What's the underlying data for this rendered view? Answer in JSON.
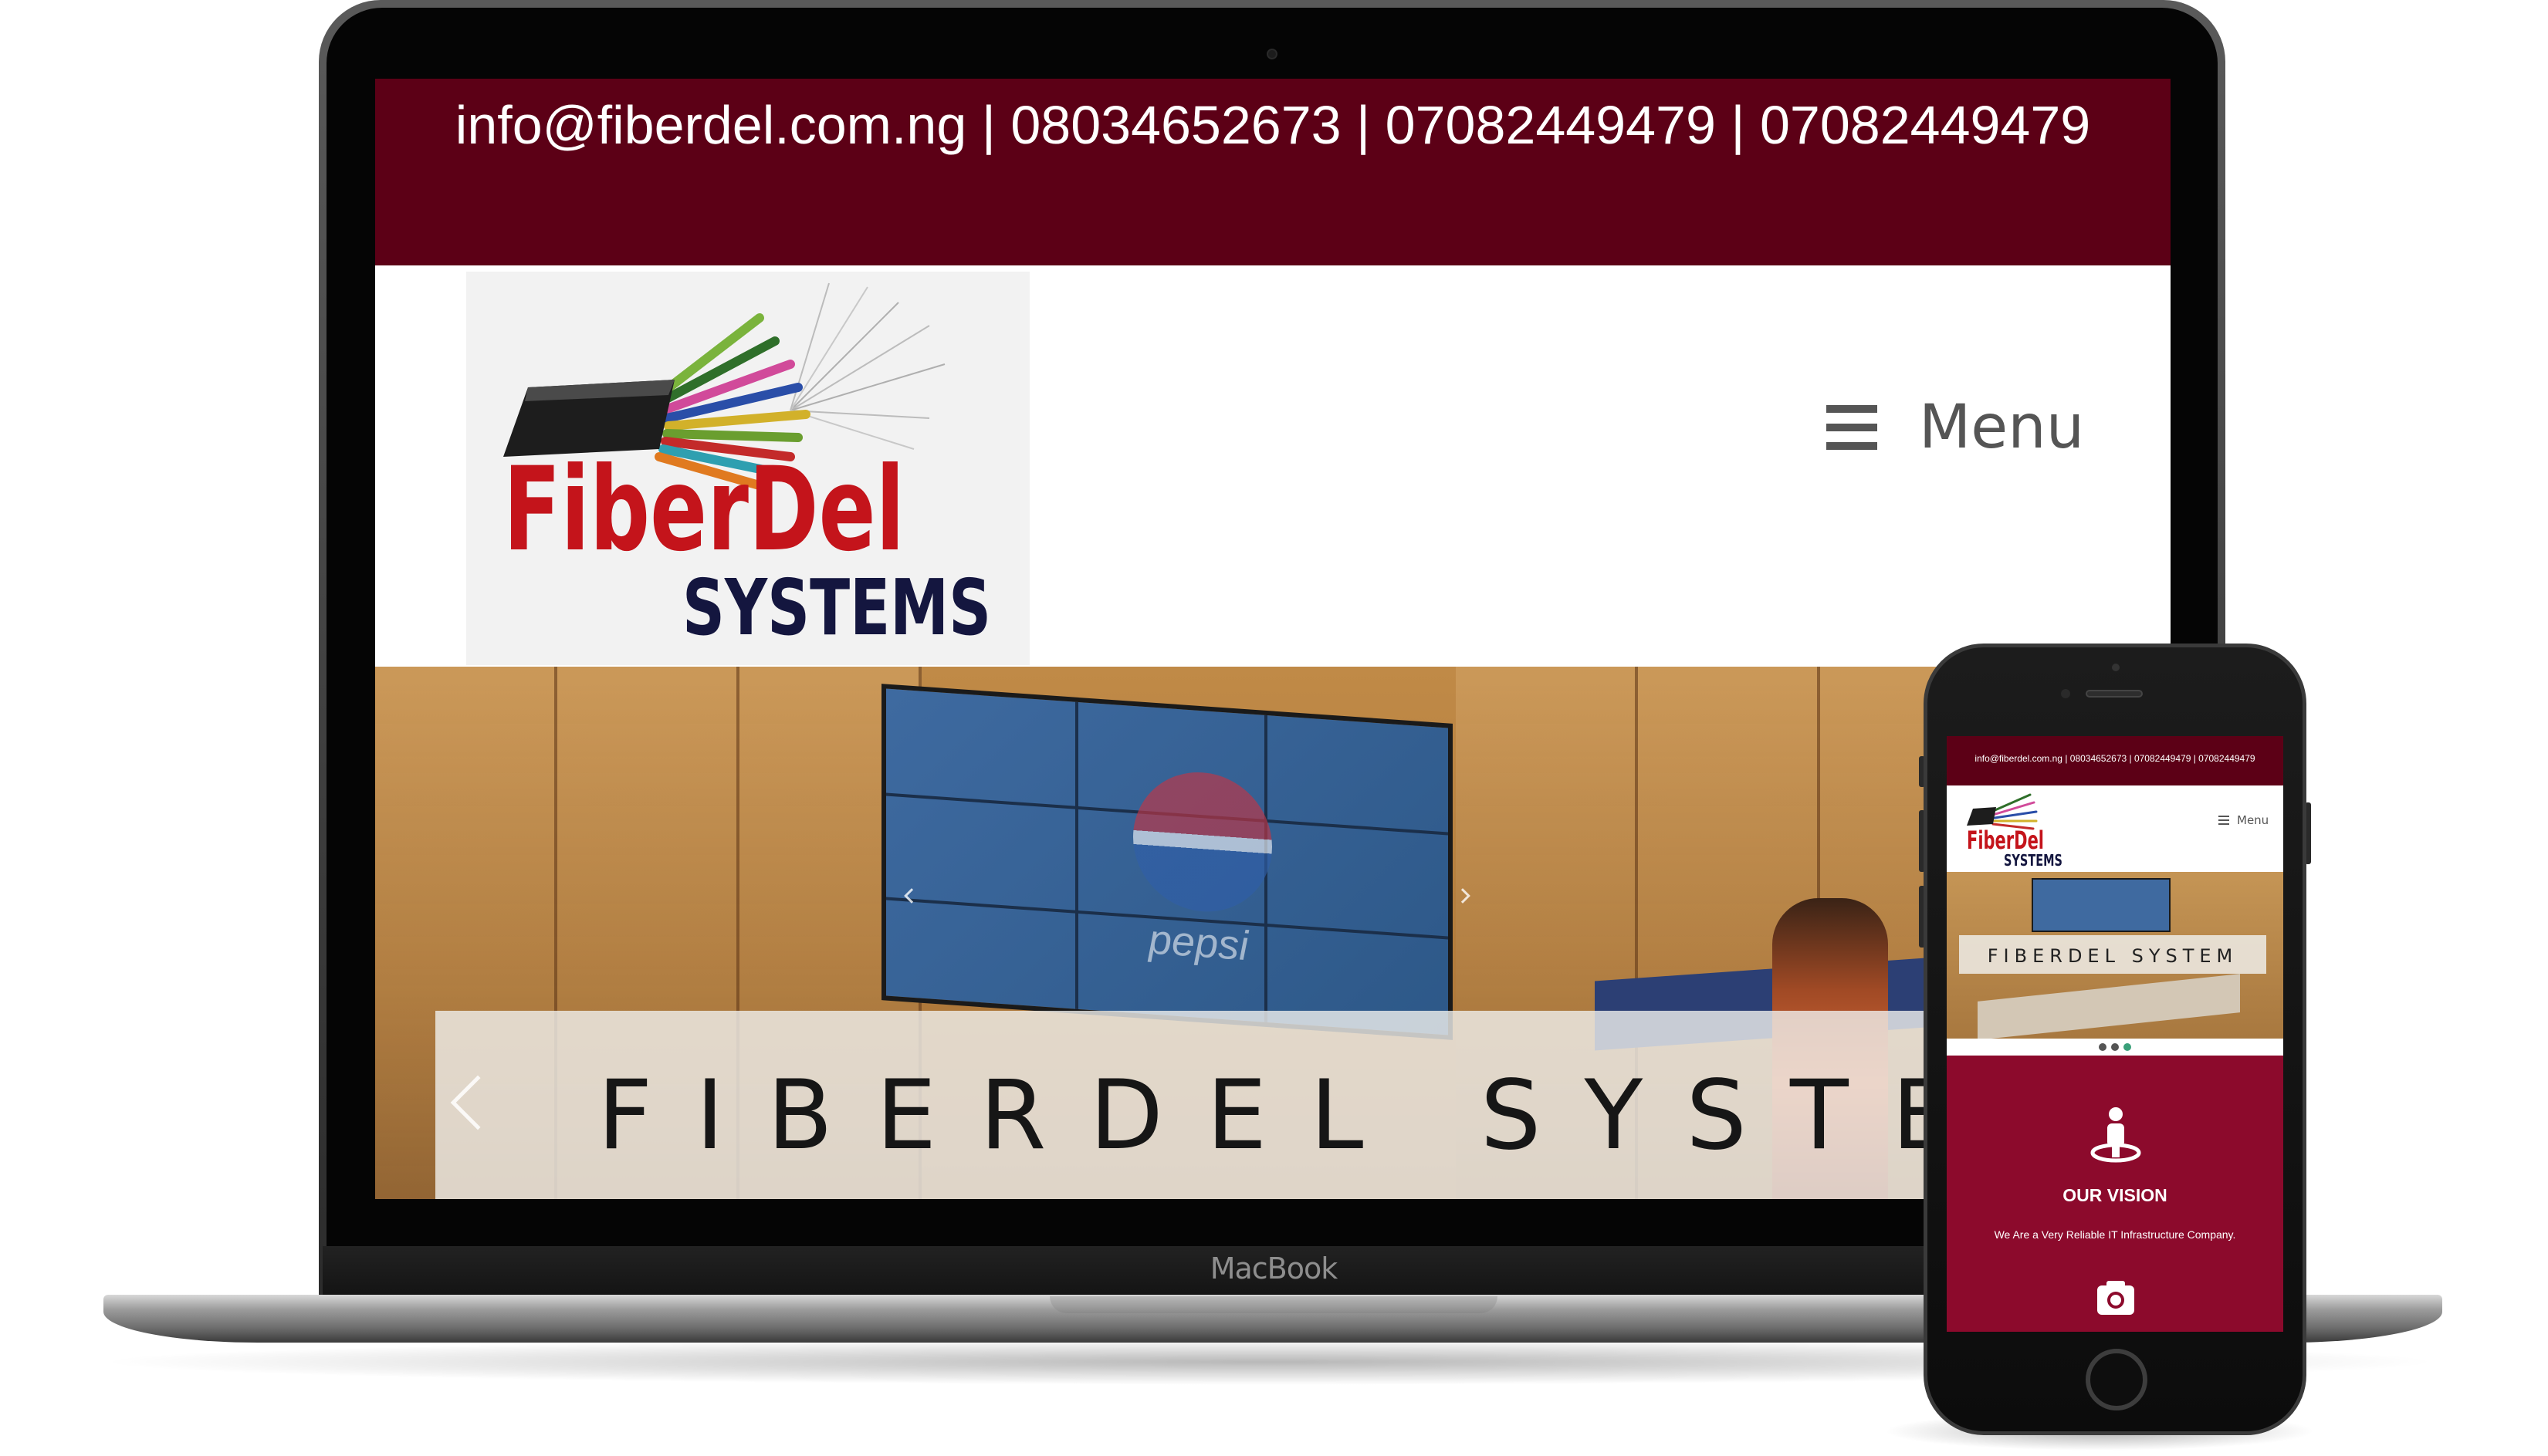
{
  "device_labels": {
    "laptop_brand": "MacBook"
  },
  "site": {
    "contact_bar": "info@fiberdel.com.ng | 08034652673 | 07082449479 | 07082449479",
    "logo": {
      "line1": "FiberDel",
      "line2": "SYSTEMS"
    },
    "menu_label": "Menu",
    "hero": {
      "caption": "FIBERDEL SYSTEM",
      "background_text": "pepsi"
    },
    "carousel": {
      "dot_count": 3,
      "active_dot": 3
    },
    "vision": {
      "title": "OUR VISION",
      "text": "We Are a Very Reliable IT Infrastructure Company."
    }
  },
  "colors": {
    "topbar": "#5c0016",
    "vision_section": "#8c0a2c",
    "logo_red": "#c4141b",
    "logo_navy": "#14163f",
    "active_dot": "#3aa07a"
  },
  "icons": {
    "menu": "hamburger-icon",
    "prev": "chevron-left-icon",
    "vision": "person-icon",
    "next_section": "camera-icon"
  }
}
